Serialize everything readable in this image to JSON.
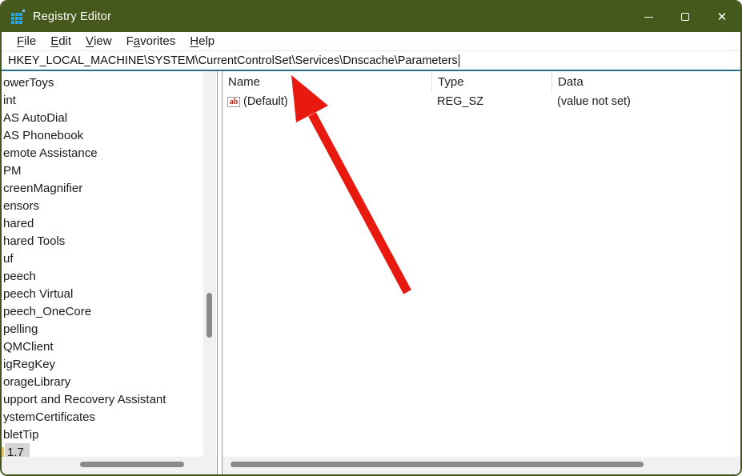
{
  "window": {
    "title": "Registry Editor"
  },
  "titlebar": {
    "close_glyph": "✕"
  },
  "menu": {
    "items": [
      {
        "pre": "",
        "key": "F",
        "post": "ile"
      },
      {
        "pre": "",
        "key": "E",
        "post": "dit"
      },
      {
        "pre": "",
        "key": "V",
        "post": "iew"
      },
      {
        "pre": "F",
        "key": "a",
        "post": "vorites"
      },
      {
        "pre": "",
        "key": "H",
        "post": "elp"
      }
    ]
  },
  "address": {
    "value": "HKEY_LOCAL_MACHINE\\SYSTEM\\CurrentControlSet\\Services\\Dnscache\\Parameters"
  },
  "tree": {
    "items": [
      {
        "label": "owerToys"
      },
      {
        "label": "int"
      },
      {
        "label": "AS AutoDial"
      },
      {
        "label": "AS Phonebook"
      },
      {
        "label": "emote Assistance"
      },
      {
        "label": "PM"
      },
      {
        "label": "creenMagnifier"
      },
      {
        "label": "ensors"
      },
      {
        "label": "hared"
      },
      {
        "label": "hared Tools"
      },
      {
        "label": "uf"
      },
      {
        "label": "peech"
      },
      {
        "label": "peech Virtual"
      },
      {
        "label": "peech_OneCore"
      },
      {
        "label": "pelling"
      },
      {
        "label": "QMClient"
      },
      {
        "label": "igRegKey"
      },
      {
        "label": "orageLibrary"
      },
      {
        "label": "upport and Recovery Assistant"
      },
      {
        "label": "ystemCertificates"
      },
      {
        "label": "bletTip"
      },
      {
        "label": "1.7",
        "selected": true
      }
    ]
  },
  "list": {
    "columns": [
      "Name",
      "Type",
      "Data"
    ],
    "rows": [
      {
        "icon": "ab",
        "name": "(Default)",
        "type": "REG_SZ",
        "data": "(value not set)"
      }
    ]
  },
  "colors": {
    "titlebar_green": "#46591d",
    "focus_underline_blue": "#2e6b8d",
    "arrow_red": "#e8190f",
    "scrollbar_thumb_gray": "#8a8a8a"
  }
}
